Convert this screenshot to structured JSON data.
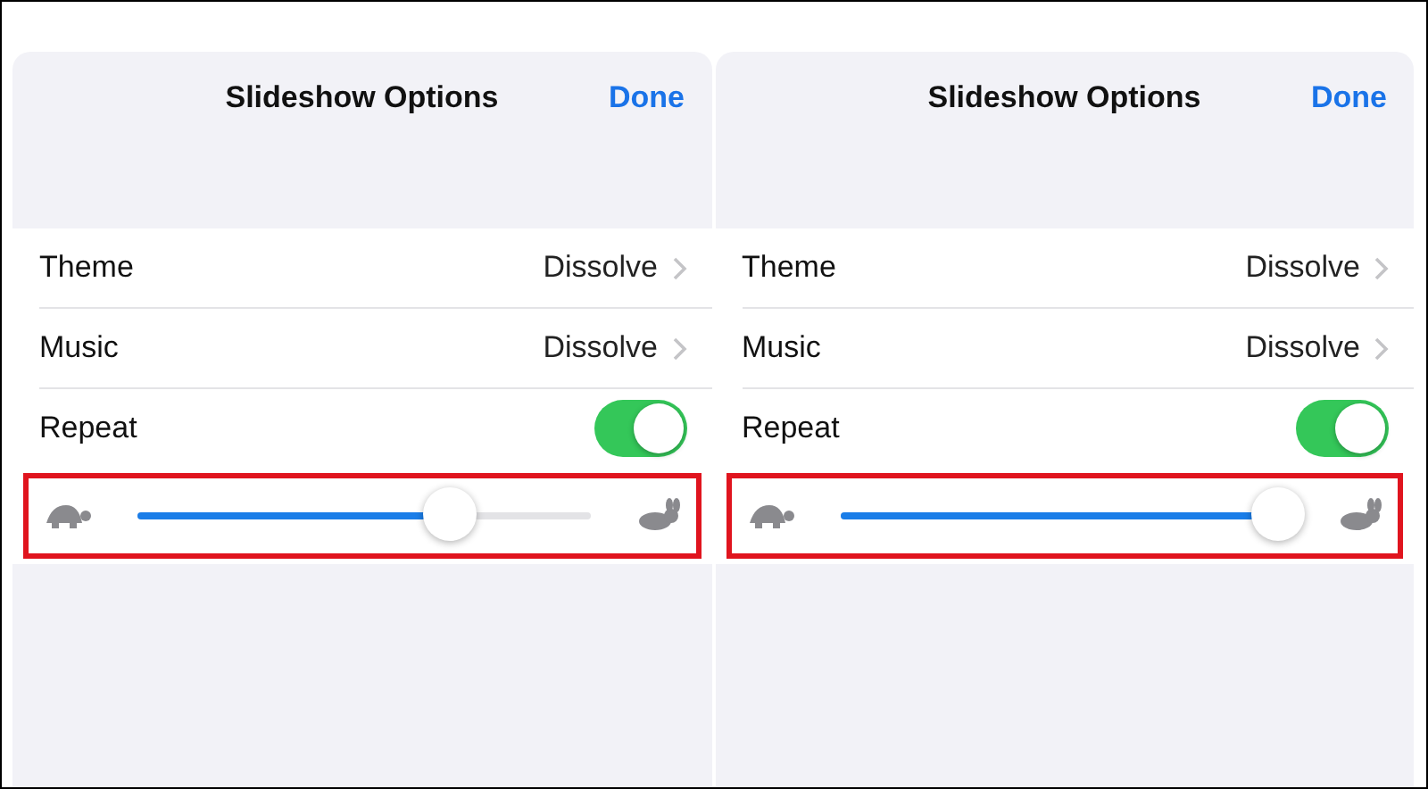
{
  "panels": [
    {
      "title": "Slideshow Options",
      "done": "Done",
      "rows": [
        {
          "kind": "disclosure",
          "label": "Theme",
          "value": "Dissolve"
        },
        {
          "kind": "disclosure",
          "label": "Music",
          "value": "Dissolve"
        },
        {
          "kind": "toggle",
          "label": "Repeat",
          "on": true
        }
      ],
      "speed": {
        "level": 0.69,
        "highlighted": true
      }
    },
    {
      "title": "Slideshow Options",
      "done": "Done",
      "rows": [
        {
          "kind": "disclosure",
          "label": "Theme",
          "value": "Dissolve"
        },
        {
          "kind": "disclosure",
          "label": "Music",
          "value": "Dissolve"
        },
        {
          "kind": "toggle",
          "label": "Repeat",
          "on": true
        }
      ],
      "speed": {
        "level": 0.97,
        "highlighted": true
      }
    }
  ]
}
